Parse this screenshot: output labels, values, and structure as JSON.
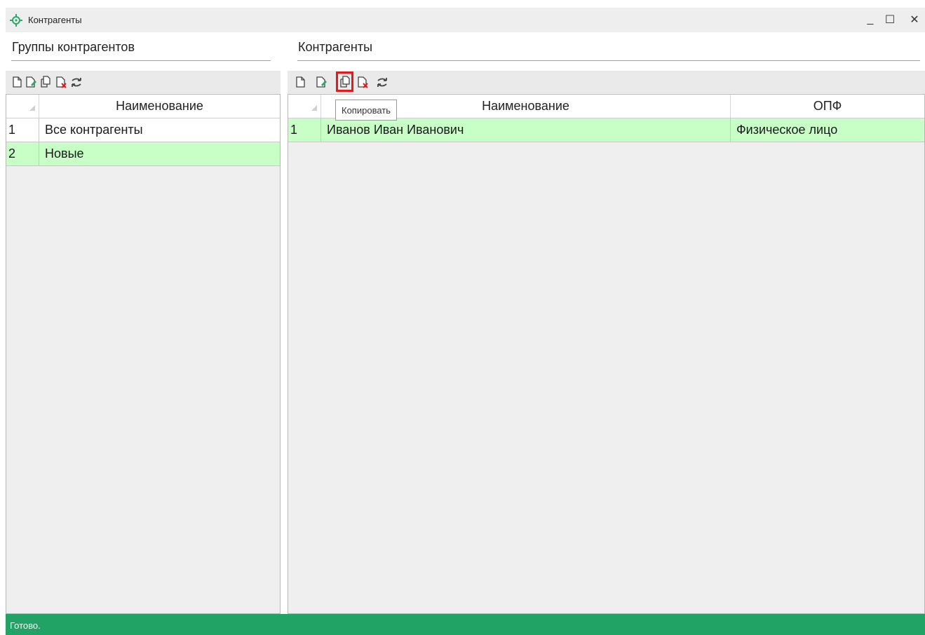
{
  "window": {
    "title": "Контрагенты",
    "icon": "counterparty-crosshair-icon",
    "minimize_label": "_",
    "maximize_label": "☐",
    "close_label": "✕"
  },
  "left_panel": {
    "title": "Группы контрагентов",
    "toolbar": [
      "new-icon",
      "edit-icon",
      "copy-icon",
      "delete-icon",
      "refresh-icon"
    ],
    "columns": [
      "Наименование"
    ],
    "rows": [
      {
        "num": "1",
        "name": "Все контрагенты",
        "style": "white"
      },
      {
        "num": "2",
        "name": "Новые",
        "style": "green",
        "selected": true
      }
    ]
  },
  "right_panel": {
    "title": "Контрагенты",
    "toolbar": [
      "new-icon",
      "edit-icon",
      "copy-icon",
      "delete-icon",
      "refresh-icon"
    ],
    "highlighted_tool": "copy-icon",
    "tooltip": "Копировать",
    "columns": [
      "Наименование",
      "ОПФ"
    ],
    "rows": [
      {
        "num": "1",
        "name": "Иванов Иван Иванович",
        "opf": "Физическое лицо",
        "style": "green",
        "selected": true
      }
    ]
  },
  "status": {
    "text": "Готово."
  },
  "colors": {
    "status_bar": "#21a366",
    "selected_row": "#c7ffc7",
    "highlight_box": "#e3191c",
    "icon_accent": "#2aa86a"
  }
}
